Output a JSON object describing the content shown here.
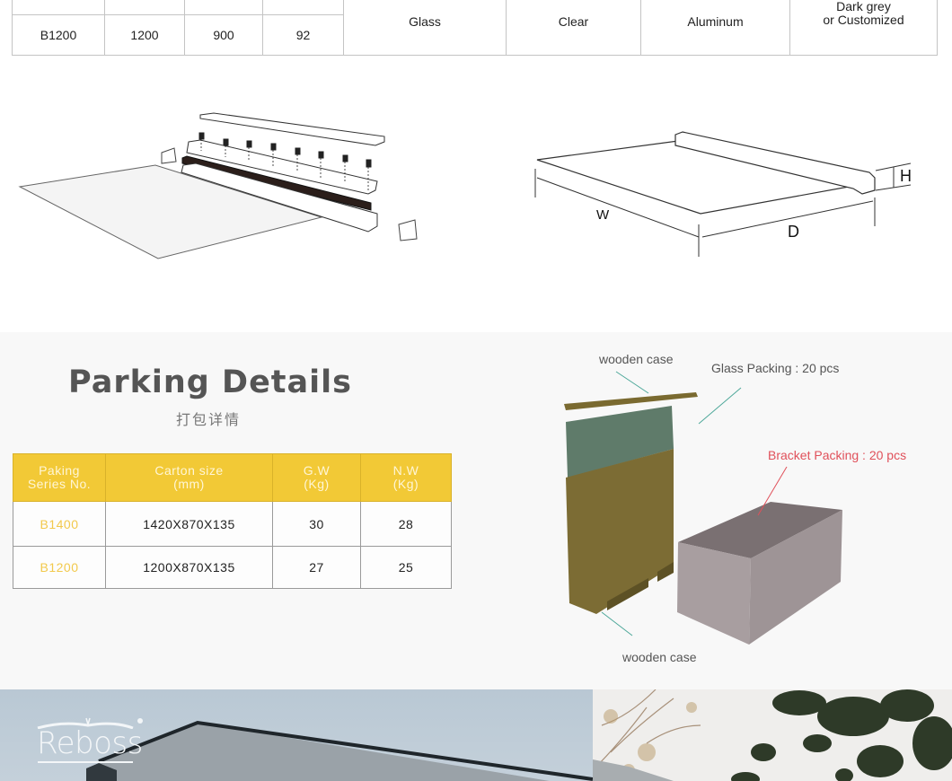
{
  "spec_table": {
    "row": {
      "series": "B1200",
      "w": "1200",
      "d": "900",
      "h": "92"
    },
    "merged": {
      "material": "Glass",
      "color": "Clear",
      "frame": "Aluminum",
      "frame_color_line1": "Dark grey",
      "frame_color_line2": "or Customized"
    }
  },
  "diagrams": {
    "exploded_view": {
      "icon": "exploded-assembly-diagram"
    },
    "dimension_view": {
      "labels": {
        "width": "W",
        "depth": "D",
        "height": "H"
      }
    }
  },
  "packing": {
    "title": "Parking Details",
    "subtitle": "打包详情",
    "table": {
      "headers": [
        [
          "Paking",
          "Series No."
        ],
        [
          "Carton size",
          "(mm)"
        ],
        [
          "G.W",
          "(Kg)"
        ],
        [
          "N.W",
          "(Kg)"
        ]
      ],
      "rows": [
        {
          "series": "B1400",
          "carton": "1420X870X135",
          "gw": "30",
          "nw": "28"
        },
        {
          "series": "B1200",
          "carton": "1200X870X135",
          "gw": "27",
          "nw": "25"
        }
      ]
    },
    "callouts": {
      "top_case": "wooden case",
      "glass": "Glass Packing : 20 pcs",
      "bracket": "Bracket Packing : 20 pcs",
      "bottom_case": "wooden case"
    },
    "colors": {
      "header": "#f2c936",
      "model_text": "#f2c94c",
      "bracket_callout": "#e0505a",
      "callout_line": "#4ea89a"
    }
  },
  "footer": {
    "logo_text": "Reboss"
  }
}
